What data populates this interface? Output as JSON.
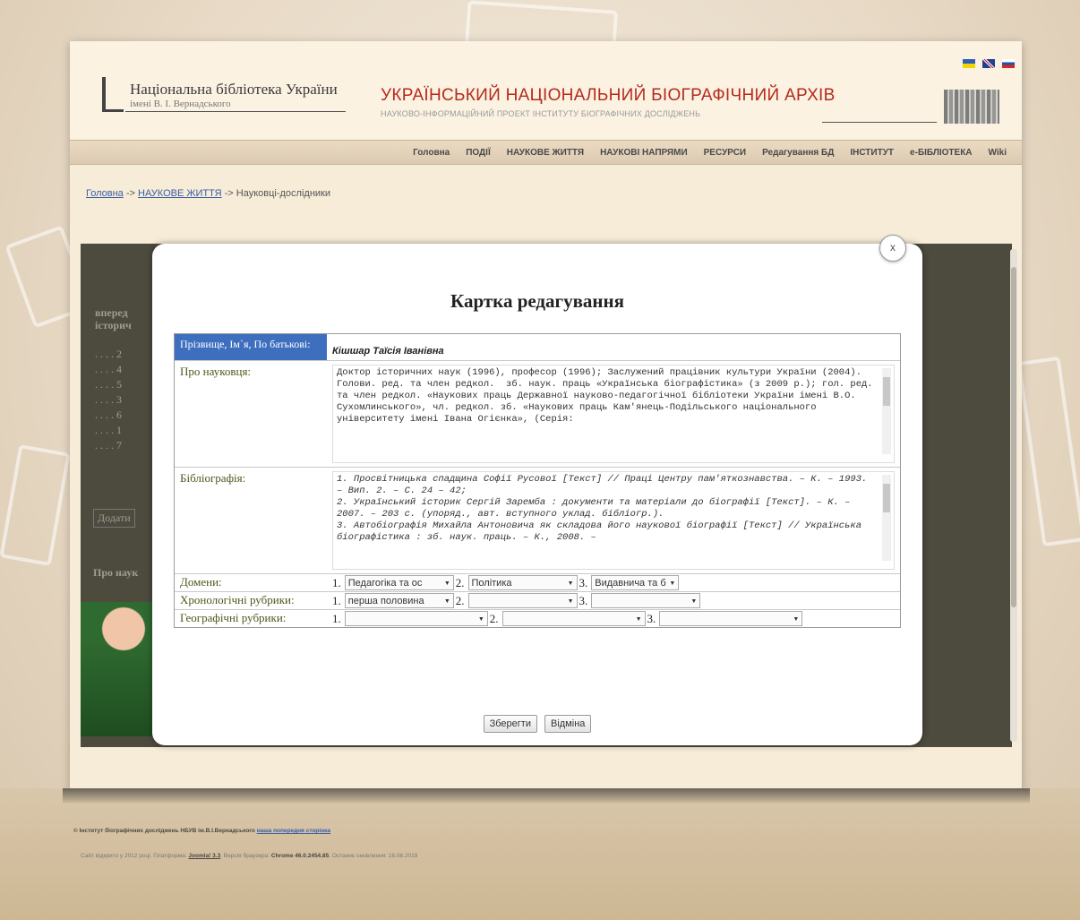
{
  "header": {
    "library_title": "Національна бібліотека України",
    "library_sub": "імені В. І. Вернадського",
    "archive_title": "УКРАЇНСЬКИЙ НАЦІОНАЛЬНИЙ БІОГРАФІЧНИЙ АРХІВ",
    "archive_sub": "НАУКОВО-ІНФОРМАЦІЙНИЙ ПРОЕКТ ІНСТИТУТУ БІОГРАФІЧНИХ ДОСЛІДЖЕНЬ",
    "flags": [
      {
        "name": "ukraine-flag-icon",
        "colors": [
          "#2f5fb5",
          "#f5d200"
        ]
      },
      {
        "name": "uk-flag-icon",
        "colors": [
          "#23408e",
          "#c8102e"
        ]
      },
      {
        "name": "russia-flag-icon",
        "colors": [
          "#ffffff",
          "#1c4fb1",
          "#d52b1e"
        ]
      }
    ]
  },
  "nav": {
    "items": [
      "Головна",
      "ПОДІЇ",
      "НАУКОВЕ ЖИТТЯ",
      "НАУКОВІ НАПРЯМИ",
      "РЕСУРСИ",
      "Редагування БД",
      "ІНСТИТУТ",
      "е-БІБЛІОТЕКА",
      "Wiki"
    ]
  },
  "breadcrumb": {
    "home": "Головна",
    "sep1": " -> ",
    "section": "НАУКОВЕ ЖИТТЯ",
    "sep2": " -> ",
    "current": "Науковці-дослідники"
  },
  "background": {
    "col_header": "вперед",
    "col_header2": "історич",
    "rows": [
      ". . . . 2",
      ". . . . 4",
      ". . . . 5",
      ". . . . 3",
      ". . . . 6",
      ". . . . 1",
      ". . . . 7"
    ],
    "add_button": "Додати",
    "about_label": "Про наук"
  },
  "modal": {
    "close": "x",
    "title": "Картка редагування",
    "fields": {
      "name_label": "Прізвище, Ім`я, По батькові:",
      "name_value": "Кішшар Таїсія Іванівна",
      "about_label": "Про науковця:",
      "about_text": "Доктор історичних наук (1996), професор (1996); Заслужений працівник культури України (2004).\nГолови. ред. та член редкол.  зб. наук. праць «Українська біографістика» (з 2009 р.); гол. ред. та член редкол. «Наукових праць Державної науково-педагогічної бібліотеки України імені В.О. Сухомлинського», чл. редкол. зб. «Наукових праць Кам'янець-Подільського національного університету імені Івана Огієнка», (Серія:",
      "bib_label": "Бібліографія:",
      "bib_text": "1. Просвітницька спадщина Софії Русової [Текст] // Праці Центру пам'яткознавства. – К. – 1993. – Вип. 2. – С. 24 – 42;\n2. Український історик Сергій Заремба : документи та матеріали до біографії [Текст]. – К. – 2007. – 203 с. (упоряд., авт. вступного уклад. бібліогр.).\n3. Автобіографія Михайла Антоновича як складова його наукової біографії [Текст] // Українська біографістика : зб. наук. праць. – К., 2008. –",
      "domains_label": "Домени:",
      "domains": [
        "Педагогіка та ос",
        "Політика",
        "Видавнича та б"
      ],
      "chrono_label": "Хронологічні рубрики:",
      "chrono": [
        "перша половина",
        "",
        ""
      ],
      "geo_label": "Географічні рубрики:",
      "geo": [
        "",
        "",
        ""
      ]
    },
    "save_button": "Зберегти",
    "cancel_button": "Відміна"
  },
  "footer": {
    "line1_text": "© Інститут біографічних досліджень НБУВ ім.В.І.Вернадського ",
    "line1_link": "наша попередня сторінка",
    "line2_a": "Сайт відкрито у 2012 році. Платформа: ",
    "line2_b": "Joomla! 3.3",
    "line2_c": ". Версія браузера: ",
    "line2_d": "Chrome 46.0.2454.85",
    "line2_e": ". Останнє оновлення: 16.08.2018"
  }
}
